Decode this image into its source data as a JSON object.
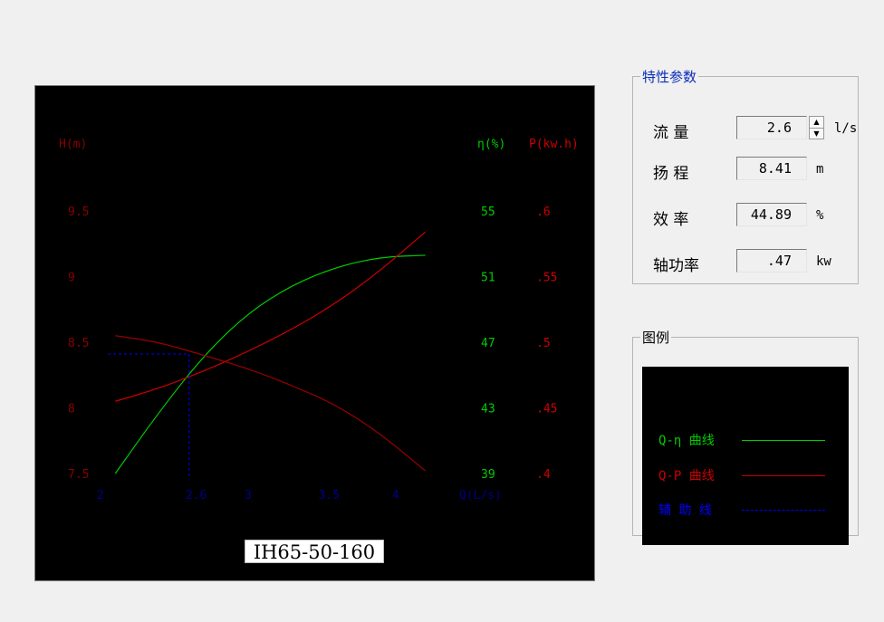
{
  "chart": {
    "title": "IH65-50-160",
    "left_axis_label": "H(m)",
    "eta_axis_label": "η(%)",
    "power_axis_label": "P(kw.h)",
    "x_axis_label": "Q(L/s)",
    "h_ticks": [
      "9.5",
      "9",
      "8.5",
      "8",
      "7.5"
    ],
    "eta_ticks": [
      "55",
      "51",
      "47",
      "43",
      "39"
    ],
    "p_ticks": [
      ".6",
      ".55",
      ".5",
      ".45",
      ".4"
    ],
    "x_ticks": [
      "2",
      "2.6",
      "3",
      "3.5",
      "4"
    ]
  },
  "chart_data": {
    "type": "line",
    "title": "IH65-50-160",
    "xlabel": "Q(L/s)",
    "ylabels": [
      "H(m)",
      "η(%)",
      "P(kw.h)"
    ],
    "xlim": [
      2,
      4.2
    ],
    "ylim_head": [
      7.5,
      9.5
    ],
    "ylim_efficiency": [
      39,
      55
    ],
    "ylim_power": [
      0.4,
      0.6
    ],
    "series": [
      {
        "name": "Q-η 曲线",
        "axis": "efficiency",
        "color": "#00cc00",
        "x": [
          2.1,
          2.4,
          2.7,
          3.0,
          3.3,
          3.6,
          3.9,
          4.2
        ],
        "y": [
          39.0,
          42.8,
          46.2,
          48.8,
          50.5,
          51.6,
          52.2,
          52.3
        ]
      },
      {
        "name": "Q-P 曲线",
        "axis": "power",
        "color": "#cc0000",
        "x": [
          2.1,
          2.4,
          2.7,
          3.0,
          3.3,
          3.6,
          3.9,
          4.2
        ],
        "y": [
          0.455,
          0.465,
          0.478,
          0.493,
          0.51,
          0.53,
          0.555,
          0.584
        ]
      },
      {
        "name": "Q-H",
        "axis": "head",
        "color": "#990000",
        "x": [
          2.1,
          2.4,
          2.7,
          3.0,
          3.3,
          3.6,
          3.9,
          4.2
        ],
        "y": [
          8.55,
          8.5,
          8.4,
          8.3,
          8.17,
          8.02,
          7.8,
          7.52
        ]
      }
    ],
    "guide": {
      "name": "辅 助 线",
      "q": 2.6,
      "h": 8.41,
      "color": "#0000ff"
    },
    "grid": false
  },
  "params": {
    "title": "特性参数",
    "flow": {
      "label": "流  量",
      "value": "2.6",
      "unit": "l/s"
    },
    "head": {
      "label": "扬  程",
      "value": "8.41",
      "unit": "m"
    },
    "efficiency": {
      "label": "效  率",
      "value": "44.89",
      "unit": "%"
    },
    "power": {
      "label": "轴功率",
      "value": ".47",
      "unit": "kw"
    }
  },
  "legend": {
    "title": "图例",
    "eta": "Q-η 曲线",
    "power": "Q-P 曲线",
    "guide": "辅 助 线"
  },
  "colors": {
    "eta": "#00cc00",
    "power": "#cc0000",
    "head": "#990000",
    "guide": "#0000ff",
    "axis_h": "#8a0000",
    "axis_x": "#00008a"
  }
}
